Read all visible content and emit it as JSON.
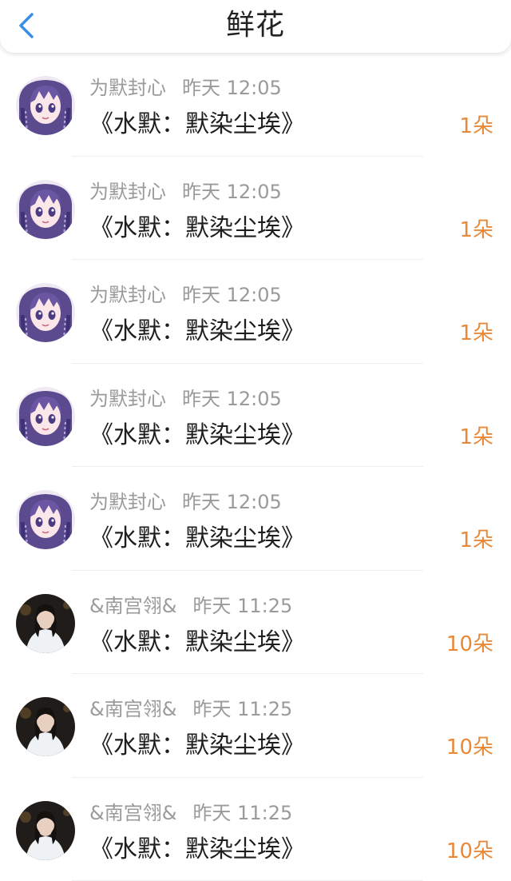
{
  "header": {
    "title": "鲜花",
    "back_icon": "chevron-left-icon",
    "accent": "#3a8ee6"
  },
  "colors": {
    "count": "#e8893a",
    "meta": "#9a9a9a",
    "book": "#1e1e1e"
  },
  "items": [
    {
      "user": "为默封心",
      "time": "昨天 12:05",
      "book": "《水默：默染尘埃》",
      "count": "1朵",
      "avatar": "anime-girl-avatar"
    },
    {
      "user": "为默封心",
      "time": "昨天 12:05",
      "book": "《水默：默染尘埃》",
      "count": "1朵",
      "avatar": "anime-girl-avatar"
    },
    {
      "user": "为默封心",
      "time": "昨天 12:05",
      "book": "《水默：默染尘埃》",
      "count": "1朵",
      "avatar": "anime-girl-avatar"
    },
    {
      "user": "为默封心",
      "time": "昨天 12:05",
      "book": "《水默：默染尘埃》",
      "count": "1朵",
      "avatar": "anime-girl-avatar"
    },
    {
      "user": "为默封心",
      "time": "昨天 12:05",
      "book": "《水默：默染尘埃》",
      "count": "1朵",
      "avatar": "anime-girl-avatar"
    },
    {
      "user": "&南宫翎&",
      "time": "昨天 11:25",
      "book": "《水默：默染尘埃》",
      "count": "10朵",
      "avatar": "photo-person-avatar"
    },
    {
      "user": "&南宫翎&",
      "time": "昨天 11:25",
      "book": "《水默：默染尘埃》",
      "count": "10朵",
      "avatar": "photo-person-avatar"
    },
    {
      "user": "&南宫翎&",
      "time": "昨天 11:25",
      "book": "《水默：默染尘埃》",
      "count": "10朵",
      "avatar": "photo-person-avatar"
    }
  ]
}
